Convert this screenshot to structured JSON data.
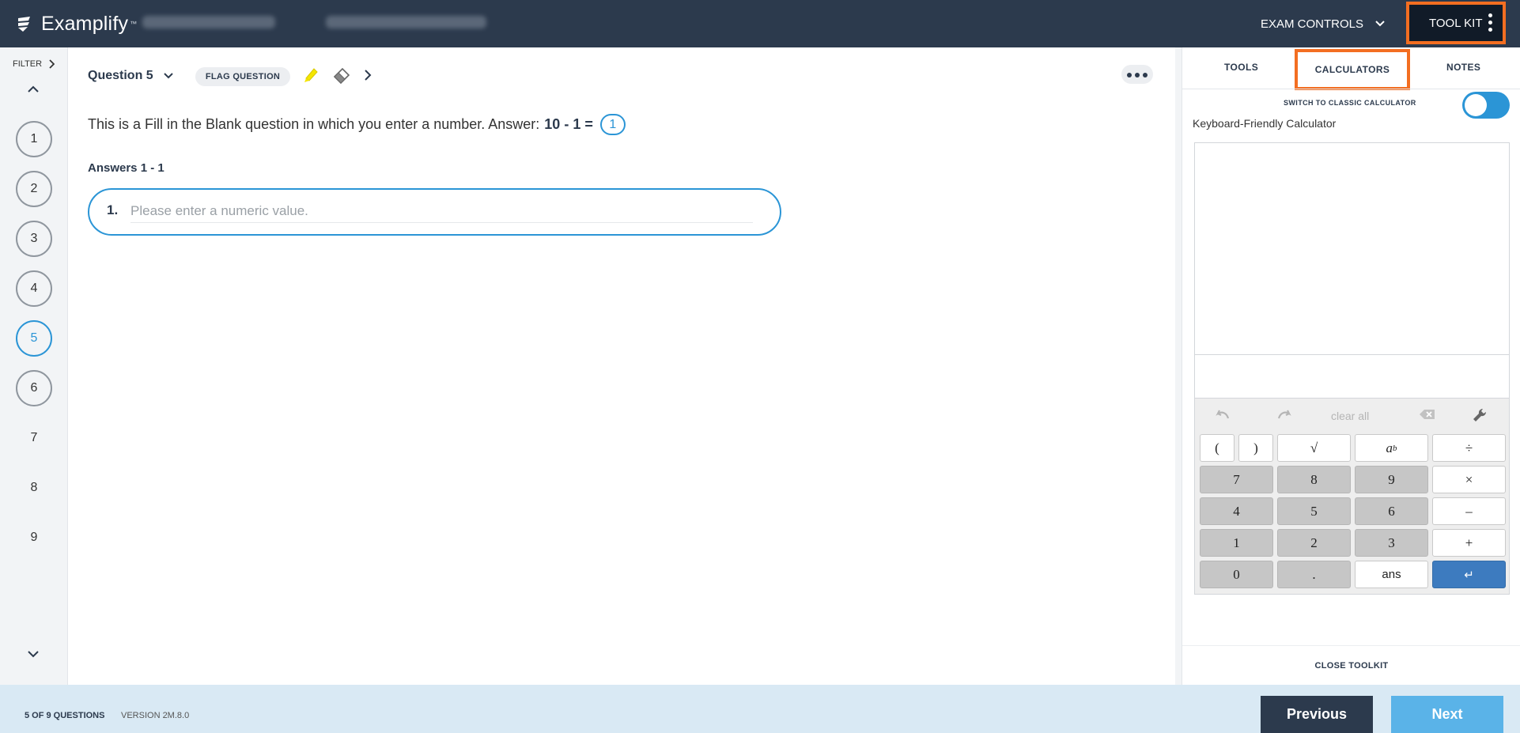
{
  "header": {
    "logo_text": "Examplify",
    "logo_tm": "™",
    "exam_controls_label": "EXAM CONTROLS",
    "toolkit_label": "TOOL KIT"
  },
  "sidebar": {
    "filter_label": "FILTER",
    "questions": [
      "1",
      "2",
      "3",
      "4",
      "5",
      "6",
      "7",
      "8",
      "9"
    ],
    "active_question": "5"
  },
  "question": {
    "title": "Question 5",
    "flag_label": "FLAG QUESTION",
    "prompt_text": "This is a Fill in the Blank question in which you enter a number. Answer:",
    "prompt_expression": "10 - 1 =",
    "blank_number": "1",
    "answers_label": "Answers 1 - 1",
    "answer_number": "1.",
    "answer_placeholder": "Please enter a numeric value."
  },
  "toolkit": {
    "tabs": [
      "TOOLS",
      "CALCULATORS",
      "NOTES"
    ],
    "active_tab": "CALCULATORS",
    "switch_label": "SWITCH TO CLASSIC CALCULATOR",
    "calculator_title": "Keyboard-Friendly Calculator",
    "clear_all": "clear all",
    "keys": {
      "open_paren": "(",
      "close_paren": ")",
      "sqrt": "√",
      "power": "a",
      "power_sup": "b",
      "divide": "÷",
      "k7": "7",
      "k8": "8",
      "k9": "9",
      "multiply": "×",
      "k4": "4",
      "k5": "5",
      "k6": "6",
      "minus": "–",
      "k1": "1",
      "k2": "2",
      "k3": "3",
      "plus": "+",
      "k0": "0",
      "dot": ".",
      "ans": "ans",
      "enter": "↵"
    },
    "close_label": "CLOSE TOOLKIT"
  },
  "footer": {
    "count": "5 OF 9 QUESTIONS",
    "version": "VERSION 2M.8.0",
    "previous": "Previous",
    "next": "Next"
  },
  "colors": {
    "header_bg": "#2c3a4d",
    "accent_blue": "#2b95d6",
    "highlight_orange": "#f36e21",
    "footer_bg": "#d9e9f4",
    "next_btn": "#5ab3e8"
  }
}
